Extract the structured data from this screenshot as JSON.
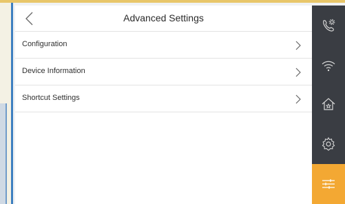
{
  "header": {
    "title": "Advanced Settings",
    "back_icon": "chevron-left-icon"
  },
  "menu": {
    "items": [
      {
        "label": "Configuration",
        "icon": "chevron-right-icon"
      },
      {
        "label": "Device Information",
        "icon": "chevron-right-icon"
      },
      {
        "label": "Shortcut Settings",
        "icon": "chevron-right-icon"
      }
    ]
  },
  "sidebar": {
    "items": [
      {
        "name": "call-settings",
        "icon": "phone-gear-icon"
      },
      {
        "name": "wifi",
        "icon": "wifi-icon"
      },
      {
        "name": "home",
        "icon": "home-icon"
      },
      {
        "name": "settings",
        "icon": "gear-icon"
      },
      {
        "name": "advanced",
        "icon": "sliders-icon",
        "active": true
      }
    ]
  },
  "colors": {
    "sidebar_bg": "#3a3d43",
    "active_tab": "#f3a833",
    "screen_bg": "#ffffff",
    "text": "#2f2f2f"
  }
}
